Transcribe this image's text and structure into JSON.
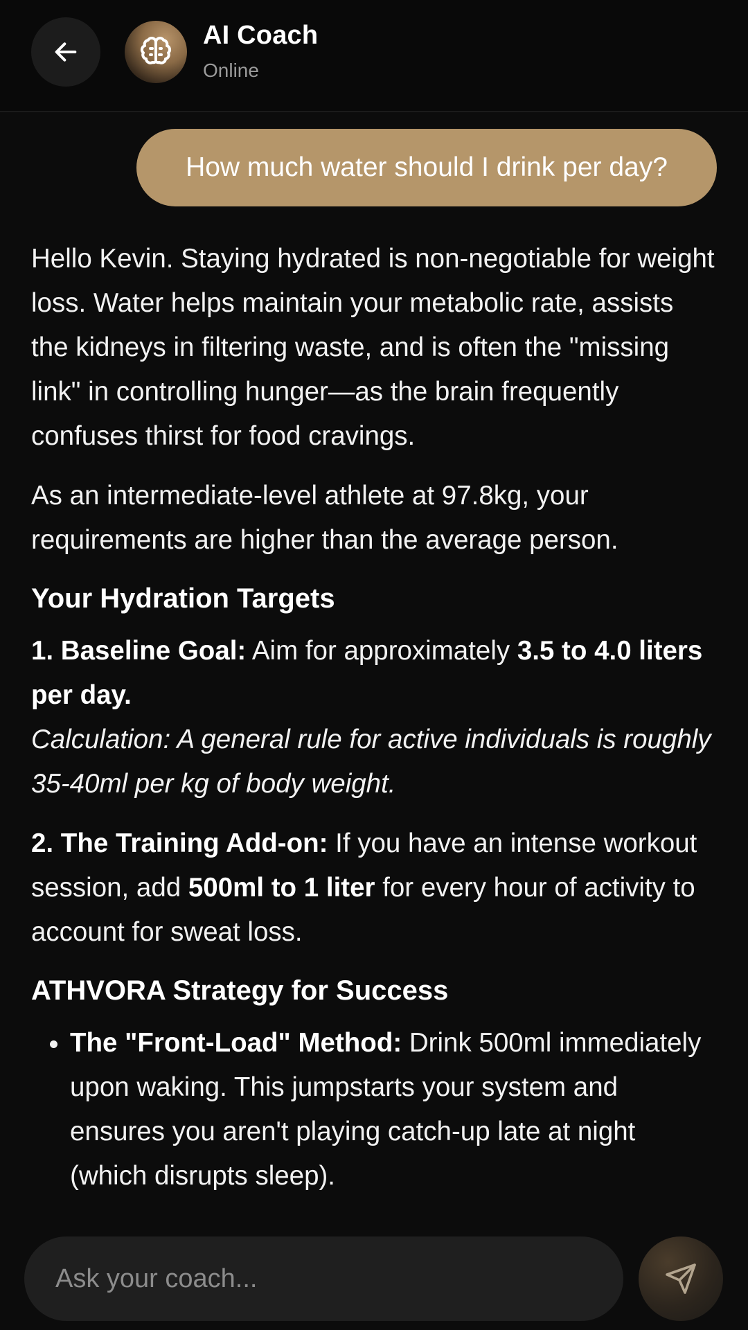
{
  "header": {
    "title": "AI Coach",
    "status": "Online",
    "back_icon": "arrow-left-icon",
    "avatar_icon": "brain-icon"
  },
  "chat": {
    "user_message": "How much water should I drink per day?",
    "reply": {
      "intro": "Hello Kevin. Staying hydrated is non-negotiable for weight loss. Water helps maintain your metabolic rate, assists the kidneys in filtering waste, and is often the \"missing link\" in controlling hunger—as the brain frequently confuses thirst for food cravings.",
      "context": "As an intermediate-level athlete at 97.8kg, your requirements are higher than the average person.",
      "section1_heading": "Your Hydration Targets",
      "item1_label": "1. Baseline Goal:",
      "item1_text": " Aim for approximately ",
      "item1_bold": "3.5 to 4.0 liters per day.",
      "item1_calc": "Calculation: A general rule for active individuals is roughly 35-40ml per kg of body weight.",
      "item2_label": "2. The Training Add-on:",
      "item2_text": " If you have an intense workout session, add ",
      "item2_bold": "500ml to 1 liter",
      "item2_text2": " for every hour of activity to account for sweat loss.",
      "section2_heading": "ATHVORA Strategy for Success",
      "bullet1_label": "The \"Front-Load\" Method:",
      "bullet1_text": " Drink 500ml immediately upon waking. This jumpstarts your system and ensures you aren't playing catch-up late at night (which disrupts sleep)."
    }
  },
  "composer": {
    "placeholder": "Ask your coach...",
    "send_icon": "send-icon"
  },
  "colors": {
    "accent": "#b5966a",
    "background": "#0c0c0c",
    "input_bg": "#1f1f1f"
  }
}
